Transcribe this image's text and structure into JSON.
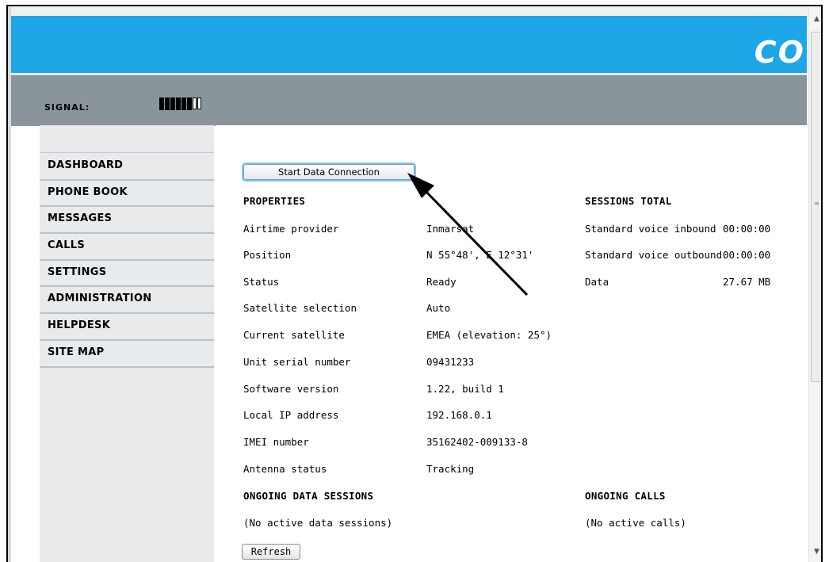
{
  "brand": {
    "logo_text": "CO"
  },
  "signal": {
    "label": "SIGNAL:",
    "bars_filled": 6,
    "bars_total": 8
  },
  "nav": {
    "items": [
      {
        "label": "DASHBOARD"
      },
      {
        "label": "PHONE BOOK"
      },
      {
        "label": "MESSAGES"
      },
      {
        "label": "CALLS"
      },
      {
        "label": "SETTINGS"
      },
      {
        "label": "ADMINISTRATION"
      },
      {
        "label": "HELPDESK"
      },
      {
        "label": "SITE MAP"
      }
    ]
  },
  "actions": {
    "start_data_connection": "Start Data Connection",
    "refresh": "Refresh"
  },
  "properties": {
    "heading": "PROPERTIES",
    "rows": [
      {
        "label": "Airtime provider",
        "value": "Inmarsat"
      },
      {
        "label": "Position",
        "value": "N 55°48', E 12°31'"
      },
      {
        "label": "Status",
        "value": "Ready"
      },
      {
        "label": "Satellite selection",
        "value": "Auto"
      },
      {
        "label": "Current satellite",
        "value": "EMEA (elevation: 25°)"
      },
      {
        "label": "Unit serial number",
        "value": "09431233"
      },
      {
        "label": "Software version",
        "value": "1.22, build 1"
      },
      {
        "label": "Local IP address",
        "value": "192.168.0.1"
      },
      {
        "label": "IMEI number",
        "value": "35162402-009133-8"
      },
      {
        "label": "Antenna status",
        "value": "Tracking"
      }
    ]
  },
  "sessions_total": {
    "heading": "SESSIONS TOTAL",
    "rows": [
      {
        "label": "Standard voice inbound",
        "value": "00:00:00"
      },
      {
        "label": "Standard voice outbound",
        "value": "00:00:00"
      },
      {
        "label": "Data",
        "value": "27.67 MB"
      }
    ]
  },
  "ongoing_data": {
    "heading": "ONGOING DATA SESSIONS",
    "message": "(No active data sessions)"
  },
  "ongoing_calls": {
    "heading": "ONGOING CALLS",
    "message": "(No active calls)"
  },
  "colors": {
    "banner": "#1ea7e6",
    "header_bar": "#8a949b",
    "sidebar": "#e8eaeb"
  }
}
